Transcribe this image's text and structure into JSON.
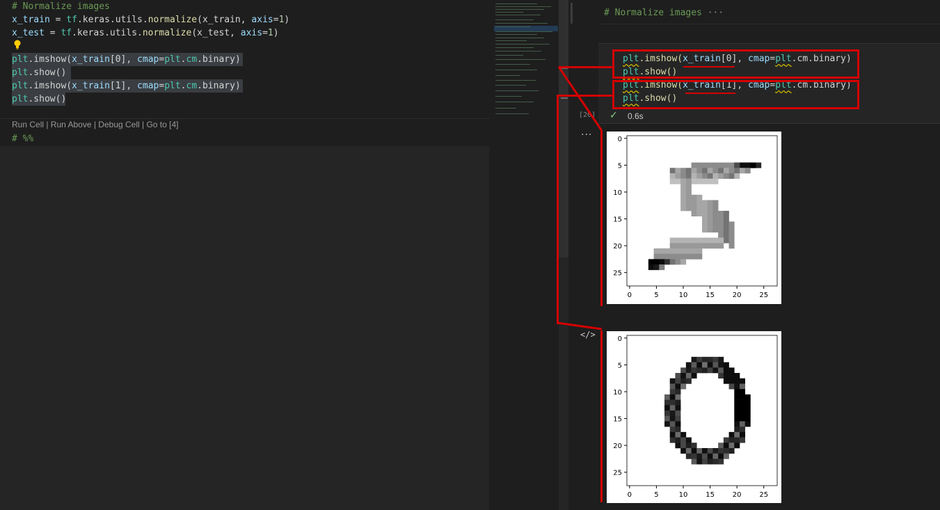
{
  "editor": {
    "lines": {
      "comment": "# Normalize images",
      "l2_var": "x_train",
      "l2_eq": " = ",
      "l2_mod": "tf",
      "l2_rest1": ".keras.utils.",
      "l2_fn": "normalize",
      "l2_rest2": "(x_train, ",
      "l2_kw": "axis",
      "l2_eq2": "=",
      "l2_num": "1",
      "l2_close": ")",
      "l3_var": "x_test",
      "l3_eq": " = ",
      "l3_mod": "tf",
      "l3_rest1": ".keras.utils.",
      "l3_fn": "normalize",
      "l3_rest2": "(x_test, ",
      "l3_kw": "axis",
      "l3_eq2": "=",
      "l3_num": "1",
      "l3_close": ")",
      "l5_mod": "plt",
      "l5_fn": ".imshow(",
      "l5_var": "x_train",
      "l5_idx": "[0], ",
      "l5_kw": "cmap",
      "l5_eq": "=",
      "l5_mod2": "plt",
      "l5_dot": ".",
      "l5_cm": "cm",
      "l5_end": ".binary)",
      "l6_mod": "plt",
      "l6_fn": ".show()",
      "l7_mod": "plt",
      "l7_fn": ".imshow(",
      "l7_var": "x_train",
      "l7_idx": "[1], ",
      "l7_kw": "cmap",
      "l7_eq": "=",
      "l7_mod2": "plt",
      "l7_dot": ".",
      "l7_cm": "cm",
      "l7_end": ".binary)",
      "l8_mod": "plt",
      "l8_fn": ".show()"
    },
    "codelens": "Run Cell | Run Above | Debug Cell | Go to [4]",
    "next_cell_marker": "# %%"
  },
  "notebook": {
    "markdown_cell": "# Normalize images",
    "markdown_ellipsis": " ···",
    "code_lines": {
      "a_mod": "plt",
      "a_fn": ".imshow(",
      "a_var": "x_train",
      "a_idx": "[0], ",
      "a_kw": "cmap",
      "a_eq": "=",
      "a_mod2": "plt",
      "a_rest": ".cm.binary)",
      "b_mod": "plt",
      "b_fn": ".show()",
      "c_mod": "plt",
      "c_fn": ".imshow(",
      "c_var": "x_train",
      "c_idx": "[1], ",
      "c_kw": "cmap",
      "c_eq": "=",
      "c_mod2": "plt",
      "c_rest": ".cm.binary)",
      "d_mod": "plt",
      "d_fn": ".show()"
    },
    "execution_count": "[20]",
    "status_icon": "check-icon",
    "duration": "0.6s",
    "output_more": "···",
    "code_icon_glyph": "</>"
  },
  "colors": {
    "annotation_red": "#d40000",
    "comment_green": "#6a9955",
    "success_green": "#89d185"
  },
  "chart_data": [
    {
      "type": "heatmap",
      "title": "",
      "image": "digit 5 (x_train[0]) rendered with binary colormap",
      "xticks": [
        0,
        5,
        10,
        15,
        20,
        25
      ],
      "yticks": [
        0,
        5,
        10,
        15,
        20,
        25
      ],
      "xlim": [
        -0.5,
        27.5
      ],
      "ylim": [
        27.5,
        -0.5
      ],
      "cmap": "binary"
    },
    {
      "type": "heatmap",
      "title": "",
      "image": "digit 0 (x_train[1]) rendered with binary colormap",
      "xticks": [
        0,
        5,
        10,
        15,
        20,
        25
      ],
      "yticks": [
        0,
        5,
        10,
        15,
        20,
        25
      ],
      "xlim": [
        -0.5,
        27.5
      ],
      "ylim": [
        27.5,
        -0.5
      ],
      "cmap": "binary"
    }
  ]
}
